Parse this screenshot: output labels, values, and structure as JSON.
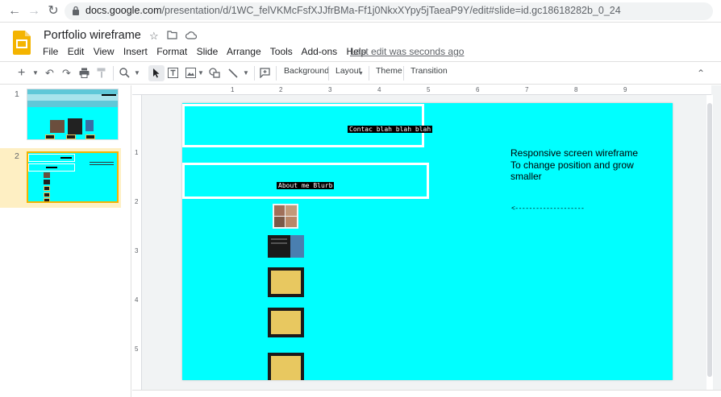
{
  "browser": {
    "url_domain": "docs.google.com",
    "url_path": "/presentation/d/1WC_felVKMcFsfXJJfrBMa-Ff1j0NkxXYpy5jTaeaP9Y/edit#slide=id.gc18618282b_0_24"
  },
  "header": {
    "title": "Portfolio wireframe",
    "menu": [
      "File",
      "Edit",
      "View",
      "Insert",
      "Format",
      "Slide",
      "Arrange",
      "Tools",
      "Add-ons",
      "Help"
    ],
    "last_edit": "Last edit was seconds ago"
  },
  "toolbar": {
    "background": "Background",
    "layout": "Layout",
    "theme": "Theme",
    "transition": "Transition"
  },
  "filmstrip": {
    "slides": [
      {
        "number": "1"
      },
      {
        "number": "2",
        "selected": true
      }
    ]
  },
  "ruler": {
    "h_marks": [
      "1",
      "2",
      "3",
      "4",
      "5",
      "6",
      "7",
      "8",
      "9"
    ],
    "v_marks": [
      "1",
      "2",
      "3",
      "4",
      "5"
    ]
  },
  "slide": {
    "contact_label": "Contac blah blah blah",
    "about_label": "About me Blurb",
    "note_line1": "Responsive screen wireframe",
    "note_line2": "To change position and grow",
    "note_line3": "smaller",
    "arrow": "<--------------------"
  },
  "colors": {
    "slide_bg": "#00ffff",
    "selected_thumb": "#feefc3",
    "accent": "#1a73e8",
    "slides_logo": "#f4b400"
  }
}
